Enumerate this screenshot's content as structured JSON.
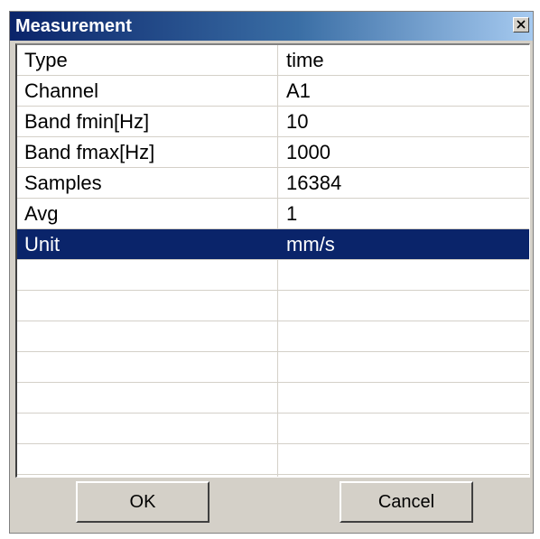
{
  "window": {
    "title": "Measurement",
    "close_icon": "close-icon"
  },
  "table": {
    "rows": [
      {
        "key": "Type",
        "value": "time"
      },
      {
        "key": "Channel",
        "value": "A1"
      },
      {
        "key": "Band fmin[Hz]",
        "value": "10"
      },
      {
        "key": "Band fmax[Hz]",
        "value": "1000"
      },
      {
        "key": "Samples",
        "value": "16384"
      },
      {
        "key": "Avg",
        "value": "1"
      },
      {
        "key": "Unit",
        "value": "mm/s"
      }
    ],
    "selected_row": "Unit",
    "selection_color": "#0a246a"
  },
  "buttons": {
    "ok_label": "OK",
    "cancel_label": "Cancel"
  }
}
